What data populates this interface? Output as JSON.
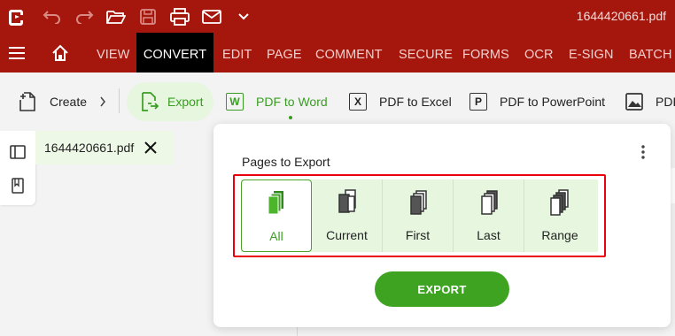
{
  "titlebar": {
    "filename": "1644420661.pdf",
    "icons": [
      "app-logo-icon",
      "undo-icon",
      "redo-icon",
      "open-folder-icon",
      "save-icon",
      "print-icon",
      "email-icon",
      "chevron-down-icon"
    ]
  },
  "menu": {
    "items": [
      "VIEW",
      "CONVERT",
      "EDIT",
      "PAGE",
      "COMMENT",
      "SECURE",
      "FORMS",
      "OCR",
      "E-SIGN",
      "BATCH"
    ],
    "active": "CONVERT"
  },
  "ribbon": {
    "create": "Create",
    "export": "Export",
    "pdf_to_word": "PDF to Word",
    "pdf_to_excel": "PDF to Excel",
    "pdf_to_powerpoint": "PDF to PowerPoint",
    "pdf_to_image": "PDF",
    "word_badge": "W",
    "excel_badge": "X",
    "ppt_badge": "P"
  },
  "document_tab": {
    "name": "1644420661.pdf"
  },
  "export_panel": {
    "title": "Pages to Export",
    "options": [
      "All",
      "Current",
      "First",
      "Last",
      "Range"
    ],
    "selected": "All",
    "button": "EXPORT"
  },
  "colors": {
    "titlebar": "#a5160c",
    "accent_green": "#3ea321",
    "highlight_red": "#e8000c"
  }
}
